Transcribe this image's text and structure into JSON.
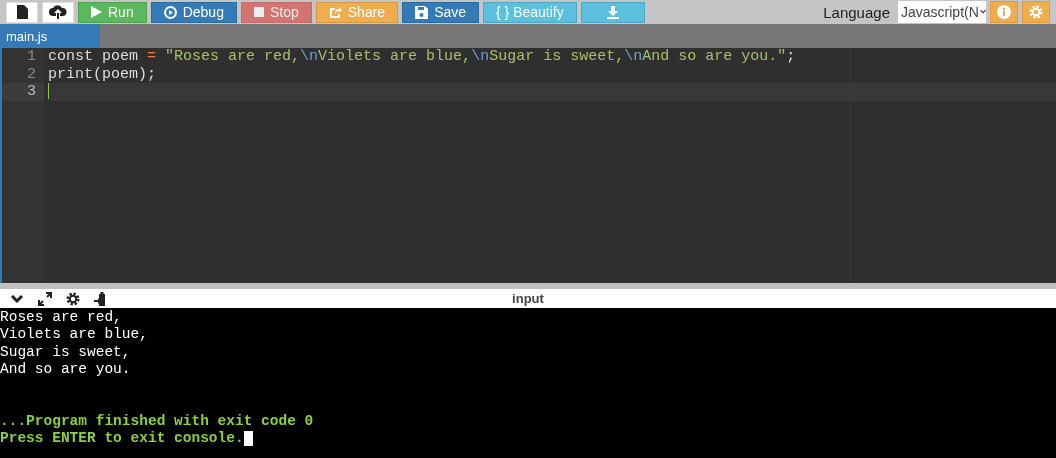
{
  "toolbar": {
    "buttons": [
      {
        "kind": "new",
        "disabled": false
      },
      {
        "kind": "upload",
        "disabled": false
      },
      {
        "kind": "run",
        "label": "Run",
        "disabled": false
      },
      {
        "kind": "debug",
        "label": "Debug",
        "disabled": false
      },
      {
        "kind": "stop",
        "label": "Stop",
        "disabled": true
      },
      {
        "kind": "share",
        "label": "Share",
        "disabled": false
      },
      {
        "kind": "save",
        "label": "Save",
        "disabled": false
      },
      {
        "kind": "beautify",
        "label": "{ } Beautify",
        "disabled": false
      },
      {
        "kind": "download",
        "disabled": false
      }
    ],
    "language_label": "Language",
    "language_value": "Javascript(N"
  },
  "tabs": [
    {
      "label": "main.js",
      "selected": true
    }
  ],
  "editor": {
    "lines": [
      {
        "number": "1",
        "active": false,
        "tokens": [
          {
            "kind": "plain",
            "text": "const poem "
          },
          {
            "kind": "operator",
            "text": "="
          },
          {
            "kind": "string",
            "text": " \"Roses are red,"
          },
          {
            "kind": "escape",
            "text": "\\n"
          },
          {
            "kind": "string",
            "text": "Violets are blue,"
          },
          {
            "kind": "escape",
            "text": "\\n"
          },
          {
            "kind": "string",
            "text": "Sugar is sweet,"
          },
          {
            "kind": "escape",
            "text": "\\n"
          },
          {
            "kind": "string",
            "text": "And so are you.\""
          },
          {
            "kind": "plain",
            "text": ";"
          }
        ]
      },
      {
        "number": "2",
        "active": false,
        "tokens": [
          {
            "kind": "plain",
            "text": "print(poem);"
          }
        ]
      },
      {
        "number": "3",
        "active": true
      }
    ]
  },
  "console": {
    "title": "input",
    "output": [
      {
        "kind": "stdout",
        "text": "Roses are red,"
      },
      {
        "kind": "stdout",
        "text": "Violets are blue,"
      },
      {
        "kind": "stdout",
        "text": "Sugar is sweet,"
      },
      {
        "kind": "stdout",
        "text": "And so are you."
      },
      {
        "kind": "blank"
      },
      {
        "kind": "blank"
      },
      {
        "kind": "status",
        "text": "...Program finished with exit code 0"
      },
      {
        "kind": "status",
        "text": "Press ENTER to exit console."
      }
    ]
  }
}
